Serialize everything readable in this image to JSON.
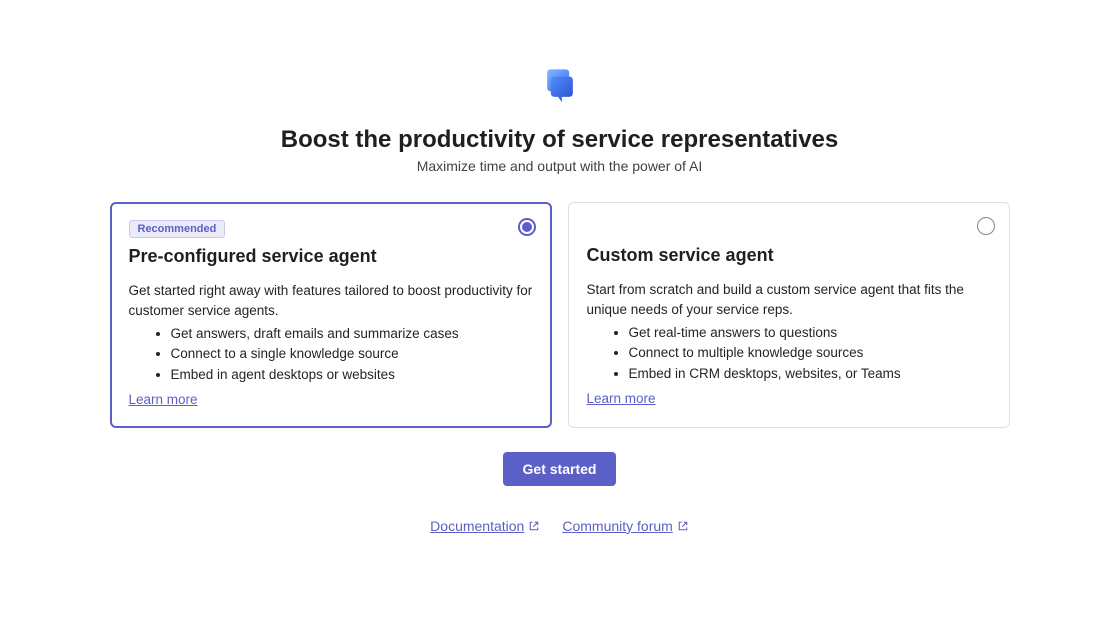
{
  "header": {
    "title": "Boost the productivity of service representatives",
    "subtitle": "Maximize time and output with the power of AI"
  },
  "cards": [
    {
      "badge": "Recommended",
      "title": "Pre-configured service agent",
      "description": "Get started right away with features tailored to boost productivity for customer service agents.",
      "bullets": [
        "Get answers, draft emails and summarize cases",
        "Connect to a single knowledge source",
        "Embed in agent desktops or websites"
      ],
      "learn_more": "Learn more",
      "selected": true
    },
    {
      "title": "Custom service agent",
      "description": "Start from scratch and build a custom service agent that fits the unique needs of your service reps.",
      "bullets": [
        "Get real-time answers to questions",
        "Connect to multiple knowledge sources",
        "Embed in CRM desktops, websites, or Teams"
      ],
      "learn_more": "Learn more",
      "selected": false
    }
  ],
  "actions": {
    "primary": "Get started"
  },
  "footer": {
    "documentation": "Documentation",
    "community": "Community forum"
  }
}
